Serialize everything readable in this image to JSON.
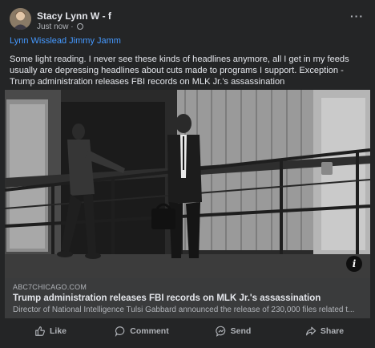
{
  "post": {
    "author": "Stacy Lynn W - f",
    "time": "Just now",
    "time_separator": "·",
    "menu_icon": "more-horizontal-icon",
    "mention": "Lynn Wisslead Jimmy Jamm",
    "body": "Some light reading. I never see these kinds of headlines anymore, all I get in my feeds usually are depressing headlines about cuts made to programs I support. Exception - Trump administration releases FBI records on MLK Jr.'s assassination"
  },
  "link_preview": {
    "domain": "ABC7CHICAGO.COM",
    "title": "Trump administration releases FBI records on MLK Jr.'s assassination",
    "description": "Director of National Intelligence Tulsi Gabbard announced the release of 230,000 files related t...",
    "info_icon": "info-icon",
    "info_label": "i"
  },
  "actions": [
    {
      "label": "Like",
      "icon": "thumbs-up-icon"
    },
    {
      "label": "Comment",
      "icon": "comment-icon"
    },
    {
      "label": "Send",
      "icon": "messenger-icon"
    },
    {
      "label": "Share",
      "icon": "share-icon"
    }
  ],
  "colors": {
    "card_bg": "#242526",
    "link_box_bg": "#3a3b3c",
    "mention": "#4599ff",
    "text_primary": "#e4e6eb",
    "text_secondary": "#b0b3b8"
  }
}
